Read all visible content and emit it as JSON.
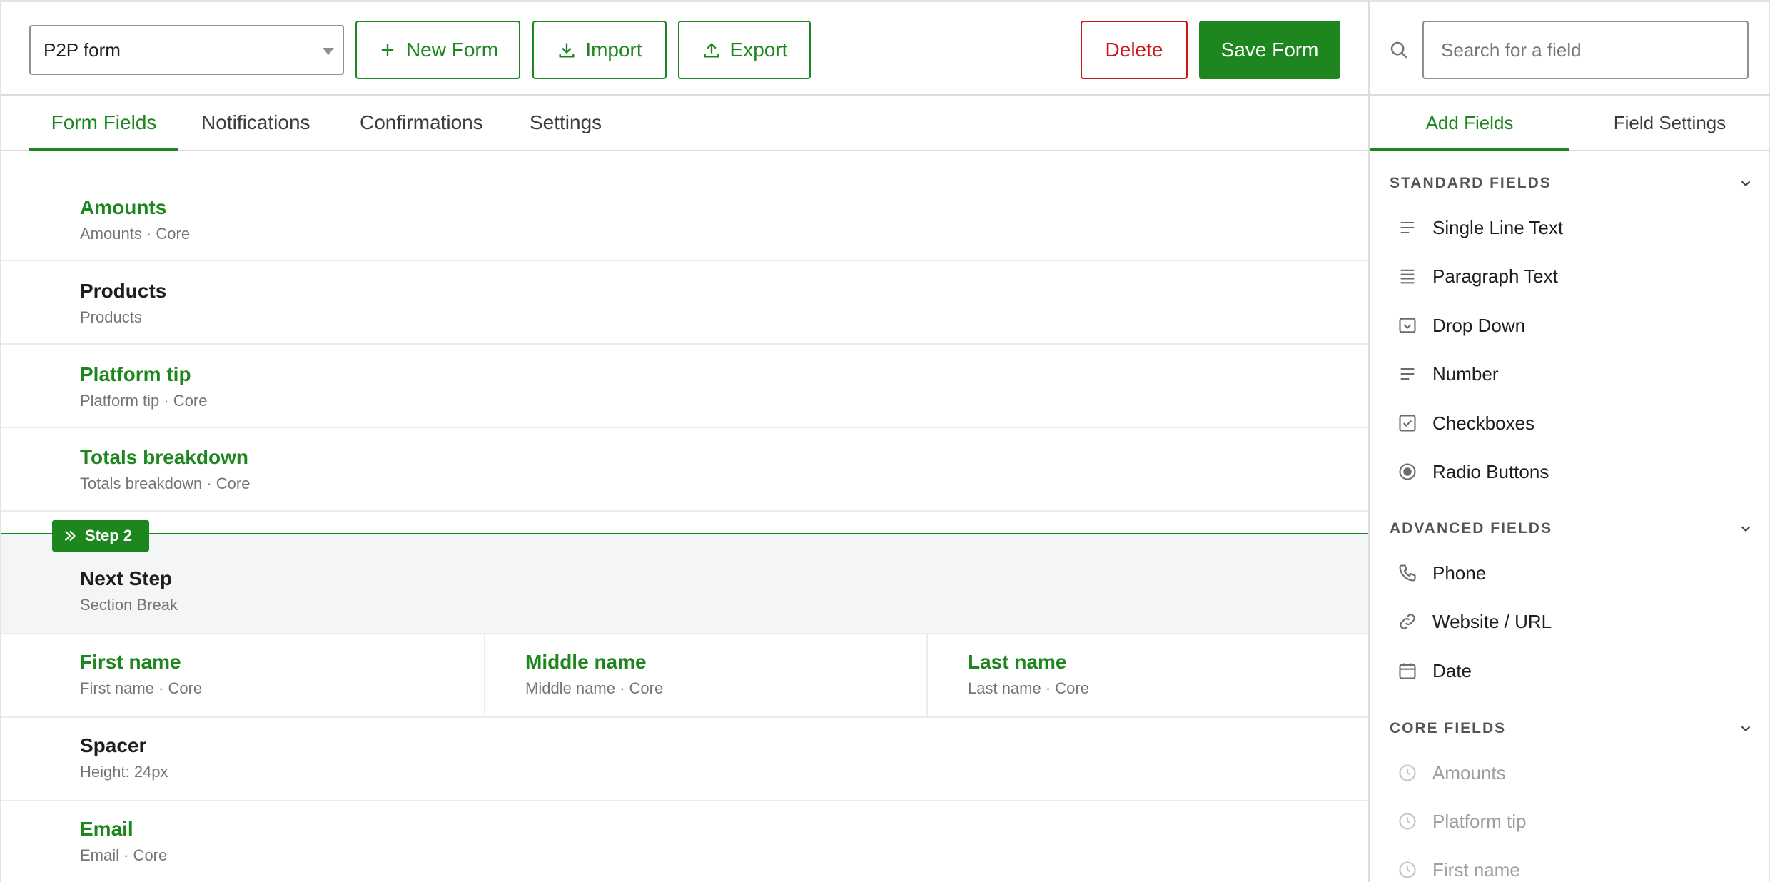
{
  "toolbar": {
    "form_select_value": "P2P form",
    "new_form_label": "New Form",
    "import_label": "Import",
    "export_label": "Export",
    "delete_label": "Delete",
    "save_label": "Save Form"
  },
  "tabs": {
    "form_fields": "Form Fields",
    "notifications": "Notifications",
    "confirmations": "Confirmations",
    "settings": "Settings"
  },
  "fields": {
    "amounts": {
      "title": "Amounts",
      "sub": "Amounts · Core"
    },
    "products": {
      "title": "Products",
      "sub": "Products"
    },
    "platform_tip": {
      "title": "Platform tip",
      "sub": "Platform tip · Core"
    },
    "totals": {
      "title": "Totals breakdown",
      "sub": "Totals breakdown · Core"
    },
    "step_badge": "Step 2",
    "next_step": {
      "title": "Next Step",
      "sub": "Section Break"
    },
    "first_name": {
      "title": "First name",
      "sub": "First name · Core"
    },
    "middle_name": {
      "title": "Middle name",
      "sub": "Middle name · Core"
    },
    "last_name": {
      "title": "Last name",
      "sub": "Last name · Core"
    },
    "spacer": {
      "title": "Spacer",
      "sub": "Height: 24px"
    },
    "email": {
      "title": "Email",
      "sub": "Email · Core"
    }
  },
  "sidebar": {
    "search_placeholder": "Search for a field",
    "tab_add": "Add Fields",
    "tab_settings": "Field Settings",
    "standard": {
      "heading": "STANDARD FIELDS",
      "items": [
        "Single Line Text",
        "Paragraph Text",
        "Drop Down",
        "Number",
        "Checkboxes",
        "Radio Buttons"
      ]
    },
    "advanced": {
      "heading": "ADVANCED FIELDS",
      "items": [
        "Phone",
        "Website / URL",
        "Date"
      ]
    },
    "core": {
      "heading": "CORE FIELDS",
      "items": [
        "Amounts",
        "Platform tip",
        "First name"
      ]
    }
  },
  "colors": {
    "accent": "#1e861e",
    "danger": "#cc1818",
    "muted": "#757575"
  }
}
